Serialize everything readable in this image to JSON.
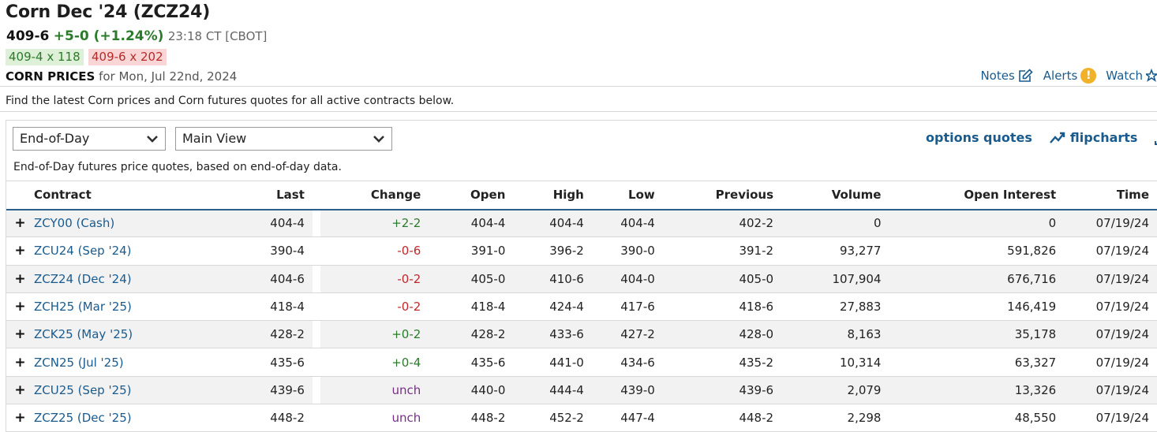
{
  "header": {
    "title": "Corn Dec '24 (ZCZ24)",
    "last": "409-6",
    "change": "+5-0 (+1.24%)",
    "time": "23:18 CT [CBOT]",
    "bid": "409-4 x 118",
    "ask": "409-6 x 202",
    "prices_label": "CORN PRICES",
    "prices_for": "for Mon, Jul 22nd, 2024"
  },
  "toplinks": {
    "notes": "Notes",
    "alerts": "Alerts",
    "alerts_badge": "!",
    "watch": "Watch"
  },
  "intro": "Find the latest Corn prices and Corn futures quotes for all active contracts below.",
  "controls": {
    "data_select": "End-of-Day",
    "view_select": "Main View",
    "options_quotes": "options quotes",
    "flipcharts": "flipcharts"
  },
  "subnote": "End-of-Day futures price quotes, based on end-of-day data.",
  "table": {
    "columns": [
      "Contract",
      "Last",
      "Change",
      "Open",
      "High",
      "Low",
      "Previous",
      "Volume",
      "Open Interest",
      "Time"
    ],
    "rows": [
      {
        "contract": "ZCY00 (Cash)",
        "last": "404-4",
        "change": "+2-2",
        "dir": "up",
        "open": "404-4",
        "high": "404-4",
        "low": "404-4",
        "previous": "402-2",
        "volume": "0",
        "oi": "0",
        "time": "07/19/24"
      },
      {
        "contract": "ZCU24 (Sep '24)",
        "last": "390-4",
        "change": "-0-6",
        "dir": "down",
        "open": "391-0",
        "high": "396-2",
        "low": "390-0",
        "previous": "391-2",
        "volume": "93,277",
        "oi": "591,826",
        "time": "07/19/24"
      },
      {
        "contract": "ZCZ24 (Dec '24)",
        "last": "404-6",
        "change": "-0-2",
        "dir": "down",
        "open": "405-0",
        "high": "410-6",
        "low": "404-0",
        "previous": "405-0",
        "volume": "107,904",
        "oi": "676,716",
        "time": "07/19/24"
      },
      {
        "contract": "ZCH25 (Mar '25)",
        "last": "418-4",
        "change": "-0-2",
        "dir": "down",
        "open": "418-4",
        "high": "424-4",
        "low": "417-6",
        "previous": "418-6",
        "volume": "27,883",
        "oi": "146,419",
        "time": "07/19/24"
      },
      {
        "contract": "ZCK25 (May '25)",
        "last": "428-2",
        "change": "+0-2",
        "dir": "up",
        "open": "428-2",
        "high": "433-6",
        "low": "427-2",
        "previous": "428-0",
        "volume": "8,163",
        "oi": "35,178",
        "time": "07/19/24"
      },
      {
        "contract": "ZCN25 (Jul '25)",
        "last": "435-6",
        "change": "+0-4",
        "dir": "up",
        "open": "435-6",
        "high": "441-0",
        "low": "434-6",
        "previous": "435-2",
        "volume": "10,314",
        "oi": "63,327",
        "time": "07/19/24"
      },
      {
        "contract": "ZCU25 (Sep '25)",
        "last": "439-6",
        "change": "unch",
        "dir": "unch",
        "open": "440-0",
        "high": "444-4",
        "low": "439-0",
        "previous": "439-6",
        "volume": "2,079",
        "oi": "13,326",
        "time": "07/19/24"
      },
      {
        "contract": "ZCZ25 (Dec '25)",
        "last": "448-2",
        "change": "unch",
        "dir": "unch",
        "open": "448-2",
        "high": "452-2",
        "low": "447-4",
        "previous": "448-2",
        "volume": "2,298",
        "oi": "48,550",
        "time": "07/19/24"
      }
    ]
  },
  "colors": {
    "link": "#1a5b8e",
    "up": "#2c7a2c",
    "down": "#c0282c",
    "unch": "#7b2b8c",
    "bid_bg": "#dff0d8",
    "ask_bg": "#f9d6d5"
  }
}
